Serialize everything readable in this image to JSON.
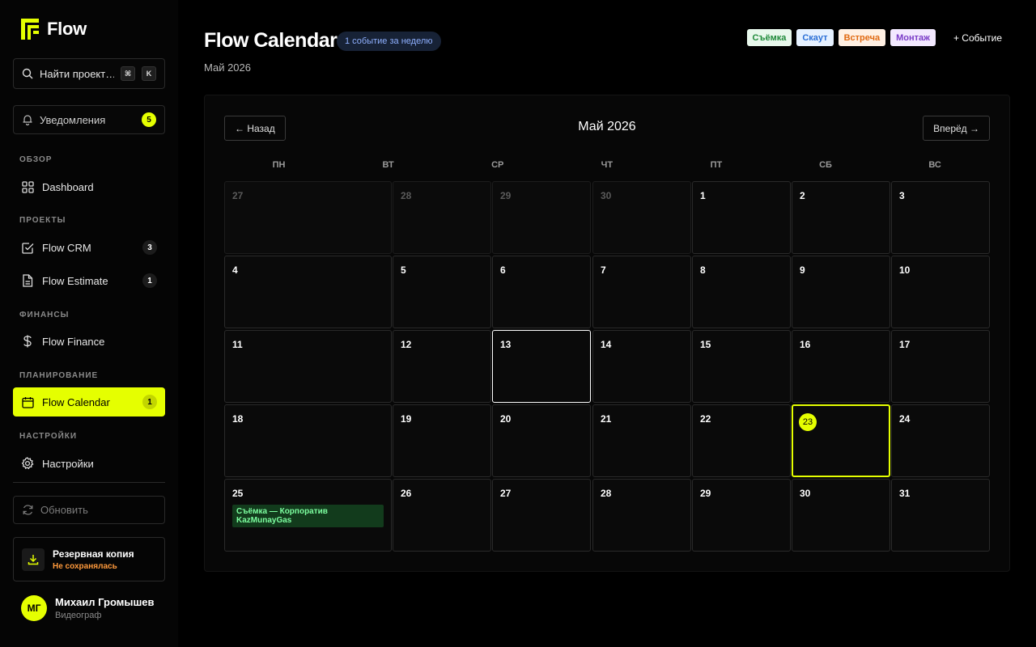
{
  "app": {
    "name": "Flow"
  },
  "search": {
    "placeholder": "Найти проект…",
    "shortcut": [
      "⌘",
      "K"
    ]
  },
  "notifications": {
    "label": "Уведомления",
    "count": "5"
  },
  "sidebar": {
    "sections": [
      {
        "title": "ОБЗОР",
        "items": [
          {
            "label": "Dashboard",
            "icon": "grid-icon",
            "count": ""
          }
        ]
      },
      {
        "title": "ПРОЕКТЫ",
        "items": [
          {
            "label": "Flow CRM",
            "icon": "checkbox-icon",
            "count": "3"
          },
          {
            "label": "Flow Estimate",
            "icon": "document-icon",
            "count": "1"
          }
        ]
      },
      {
        "title": "ФИНАНСЫ",
        "items": [
          {
            "label": "Flow Finance",
            "icon": "dollar-icon",
            "count": ""
          }
        ]
      },
      {
        "title": "ПЛАНИРОВАНИЕ",
        "items": [
          {
            "label": "Flow Calendar",
            "icon": "calendar-icon",
            "count": "1",
            "active": true
          }
        ]
      },
      {
        "title": "НАСТРОЙКИ",
        "items": [
          {
            "label": "Настройки",
            "icon": "gear-icon",
            "count": ""
          }
        ]
      }
    ],
    "refresh_label": "Обновить",
    "backup": {
      "title": "Резервная копия",
      "status": "Не сохранялась"
    },
    "user": {
      "initials": "МГ",
      "name": "Михаил Громышев",
      "role": "Видеограф"
    }
  },
  "header": {
    "title": "Flow Calendar",
    "week_badge": "1 событие за неделю",
    "subtitle": "Май 2026",
    "tags": [
      {
        "label": "Съёмка",
        "bg": "#e8f8ec",
        "color": "#1f8a3a"
      },
      {
        "label": "Скаут",
        "bg": "#e6f1ff",
        "color": "#2b6fd6"
      },
      {
        "label": "Встреча",
        "bg": "#fff0e3",
        "color": "#e06a12"
      },
      {
        "label": "Монтаж",
        "bg": "#f3e9ff",
        "color": "#7a3cc8"
      }
    ],
    "add_event": "+ Событие"
  },
  "calendar": {
    "prev": "← Назад",
    "next": "Вперёд →",
    "month_title": "Май 2026",
    "weekdays": [
      "ПН",
      "ВТ",
      "СР",
      "ЧТ",
      "ПТ",
      "СБ",
      "ВС"
    ],
    "weeks": [
      [
        {
          "n": "27",
          "other": true
        },
        {
          "n": "28",
          "other": true
        },
        {
          "n": "29",
          "other": true
        },
        {
          "n": "30",
          "other": true
        },
        {
          "n": "1"
        },
        {
          "n": "2"
        },
        {
          "n": "3"
        }
      ],
      [
        {
          "n": "4"
        },
        {
          "n": "5"
        },
        {
          "n": "6"
        },
        {
          "n": "7"
        },
        {
          "n": "8"
        },
        {
          "n": "9"
        },
        {
          "n": "10"
        }
      ],
      [
        {
          "n": "11"
        },
        {
          "n": "12"
        },
        {
          "n": "13",
          "selected": true
        },
        {
          "n": "14"
        },
        {
          "n": "15"
        },
        {
          "n": "16"
        },
        {
          "n": "17"
        }
      ],
      [
        {
          "n": "18"
        },
        {
          "n": "19"
        },
        {
          "n": "20"
        },
        {
          "n": "21"
        },
        {
          "n": "22"
        },
        {
          "n": "23",
          "today": true
        },
        {
          "n": "24"
        }
      ],
      [
        {
          "n": "25",
          "events": [
            "Съёмка — Корпоратив KazMunayGas"
          ]
        },
        {
          "n": "26"
        },
        {
          "n": "27"
        },
        {
          "n": "28"
        },
        {
          "n": "29"
        },
        {
          "n": "30"
        },
        {
          "n": "31"
        }
      ]
    ]
  },
  "colors": {
    "accent": "#e5ff00",
    "background": "#000000",
    "event_bg": "#123b1c",
    "event_text": "#7dffa0"
  }
}
